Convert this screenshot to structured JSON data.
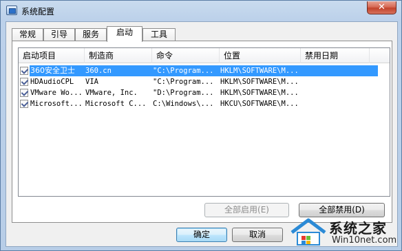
{
  "window": {
    "title": "系统配置",
    "close_glyph": "✕"
  },
  "tabs": [
    {
      "label": "常规",
      "active": false
    },
    {
      "label": "引导",
      "active": false
    },
    {
      "label": "服务",
      "active": false
    },
    {
      "label": "启动",
      "active": true
    },
    {
      "label": "工具",
      "active": false
    }
  ],
  "startup_list": {
    "columns": [
      "启动项目",
      "制造商",
      "命令",
      "位置",
      "禁用日期"
    ],
    "rows": [
      {
        "checked": true,
        "selected": true,
        "item": "360安全卫士",
        "maker": "360.cn",
        "command": "\"C:\\Program...",
        "location": "HKLM\\SOFTWARE\\M...",
        "disabled_date": ""
      },
      {
        "checked": true,
        "selected": false,
        "item": "HDAudioCPL",
        "maker": "VIA",
        "command": "\"C:\\Program...",
        "location": "HKLM\\SOFTWARE\\M...",
        "disabled_date": ""
      },
      {
        "checked": true,
        "selected": false,
        "item": "VMware Wo...",
        "maker": "VMware, Inc.",
        "command": "\"D:\\Program...",
        "location": "HKLM\\SOFTWARE\\M...",
        "disabled_date": ""
      },
      {
        "checked": true,
        "selected": false,
        "item": "Microsoft...",
        "maker": "Microsoft C...",
        "command": "C:\\Windows\\...",
        "location": "HKCU\\SOFTWARE\\M...",
        "disabled_date": ""
      }
    ]
  },
  "buttons": {
    "enable_all": "全部启用(E)",
    "disable_all": "全部禁用(D)",
    "ok": "确定",
    "cancel": "取消"
  },
  "watermark": {
    "brand": "系统之家",
    "url": "Win10net.com"
  },
  "colors": {
    "selection": "#3399ff",
    "close_button": "#c2432b",
    "window_frame": "#bcd1ea"
  }
}
